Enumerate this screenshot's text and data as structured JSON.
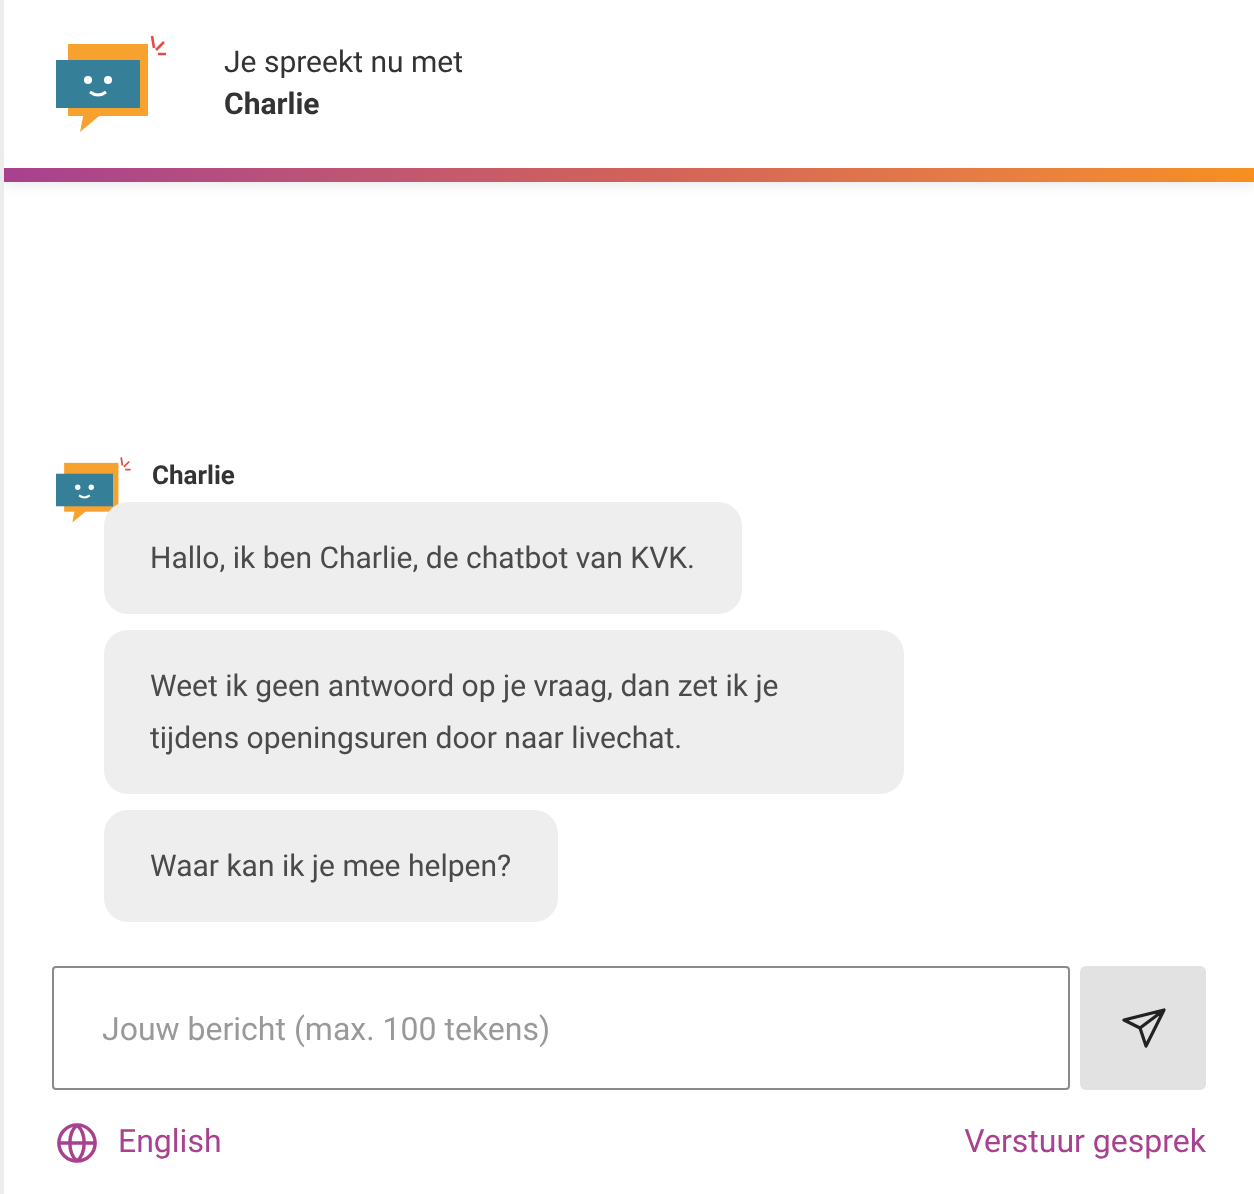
{
  "header": {
    "subtitle": "Je spreekt nu met",
    "name": "Charlie"
  },
  "conversation": {
    "sender": "Charlie",
    "messages": [
      "Hallo, ik ben Charlie, de chatbot van KVK.",
      "Weet ik geen antwoord op je vraag, dan zet ik je tijdens openingsuren door naar livechat.",
      "Waar kan ik je mee helpen?"
    ]
  },
  "composer": {
    "placeholder": "Jouw bericht (max. 100 tekens)"
  },
  "footer": {
    "language": "English",
    "send_conversation": "Verstuur gesprek"
  }
}
